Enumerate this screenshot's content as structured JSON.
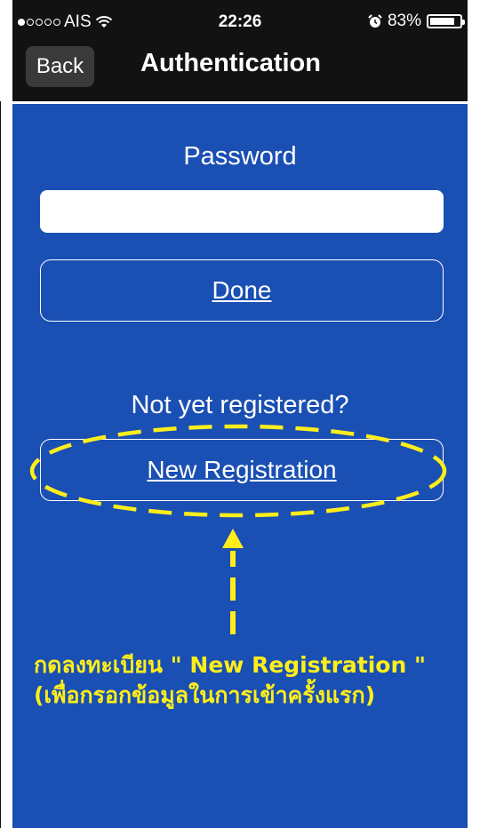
{
  "status_bar": {
    "carrier": "AIS",
    "signal_bars_filled": 1,
    "signal_bars_total": 5,
    "time": "22:26",
    "battery_percent": "83%",
    "battery_level": 0.83,
    "alarm_icon": "alarm-clock-icon",
    "wifi_icon": "wifi-icon"
  },
  "nav": {
    "back_label": "Back",
    "title": "Authentication"
  },
  "form": {
    "password_label": "Password",
    "password_value": "",
    "done_label": "Done",
    "not_registered_text": "Not yet registered?",
    "new_registration_label": "New Registration"
  },
  "annotation": {
    "line1": "กดลงทะเบียน \" New Registration \"",
    "line2": "(เพื่อกรอกข้อมูลในการเข้าครั้งแรก)",
    "color": "#ffee1a"
  },
  "colors": {
    "background": "#1a4fb3",
    "topbar": "#121212",
    "back_button": "#3a3a3a"
  }
}
